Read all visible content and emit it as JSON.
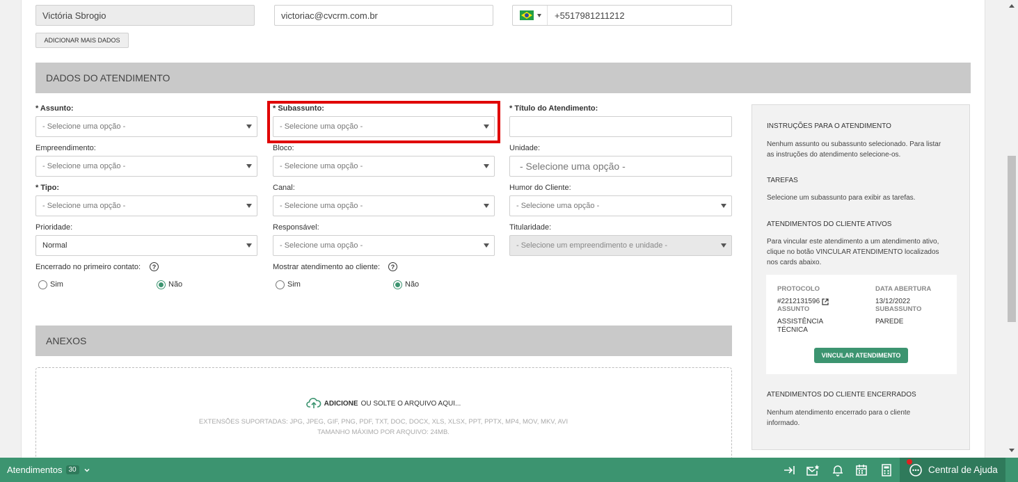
{
  "contact": {
    "name": "Victória Sbrogio",
    "email": "victoriac@cvcrm.com.br",
    "phone": "+5517981211212",
    "add_more_label": "ADICIONAR MAIS DADOS"
  },
  "section_atendimento": "DADOS DO ATENDIMENTO",
  "fields": {
    "assunto": {
      "label": "* Assunto:",
      "value": "- Selecione uma opção -"
    },
    "subassunto": {
      "label": "* Subassunto:",
      "value": "- Selecione uma opção -"
    },
    "titulo": {
      "label": "* Título do Atendimento:",
      "value": ""
    },
    "empreendimento": {
      "label": "Empreendimento:",
      "value": "- Selecione uma opção -"
    },
    "bloco": {
      "label": "Bloco:",
      "value": "- Selecione uma opção -"
    },
    "unidade": {
      "label": "Unidade:",
      "value": "- Selecione uma opção -"
    },
    "tipo": {
      "label": "* Tipo:",
      "value": "- Selecione uma opção -"
    },
    "canal": {
      "label": "Canal:",
      "value": "- Selecione uma opção -"
    },
    "humor": {
      "label": "Humor do Cliente:",
      "value": "- Selecione uma opção -"
    },
    "prioridade": {
      "label": "Prioridade:",
      "value": "Normal"
    },
    "responsavel": {
      "label": "Responsável:",
      "value": "- Selecione uma opção -"
    },
    "titularidade": {
      "label": "Titularidade:",
      "value": "- Selecione um empreendimento e unidade -"
    }
  },
  "encerrado": {
    "label": "Encerrado no primeiro contato:",
    "yes": "Sim",
    "no": "Não",
    "selected": "Não"
  },
  "mostrar": {
    "label": "Mostrar atendimento ao cliente:",
    "yes": "Sim",
    "no": "Não",
    "selected": "Não"
  },
  "section_anexos": "ANEXOS",
  "upload": {
    "action": "ADICIONE",
    "rest": "OU SOLTE O ARQUIVO AQUI...",
    "extensions": "EXTENSÕES SUPORTADAS: JPG, JPEG, GIF, PNG, PDF, TXT, DOC, DOCX, XLS, XLSX, PPT, PPTX, MP4, MOV, MKV, AVI",
    "max_size": "TAMANHO MÁXIMO POR ARQUIVO: 24MB."
  },
  "sidebar": {
    "instructions_title": "INSTRUÇÕES PARA O ATENDIMENTO",
    "instructions_text": "Nenhum assunto ou subassunto selecionado. Para listar as instruções do atendimento selecione-os.",
    "tasks_title": "TAREFAS",
    "tasks_text": "Selecione um subassunto para exibir as tarefas.",
    "active_title": "ATENDIMENTOS DO CLIENTE ATIVOS",
    "active_text": "Para vincular este atendimento a um atendimento ativo, clique no botão VINCULAR ATENDIMENTO localizados nos cards abaixo.",
    "card": {
      "protocol_label": "PROTOCOLO",
      "protocol_value": "#2212131596",
      "date_label": "DATA ABERTURA",
      "date_value": "13/12/2022",
      "assunto_label": "ASSUNTO",
      "assunto_value": "ASSISTÊNCIA TÉCNICA",
      "subassunto_label": "SUBASSUNTO",
      "subassunto_value": "PAREDE",
      "link_button": "VINCULAR ATENDIMENTO"
    },
    "closed_title": "ATENDIMENTOS DO CLIENTE ENCERRADOS",
    "closed_text": "Nenhum atendimento encerrado para o cliente informado."
  },
  "bottombar": {
    "label": "Atendimentos",
    "count": "30",
    "help": "Central de Ajuda"
  },
  "colors": {
    "primary": "#3c9470",
    "highlight": "#e00000",
    "section": "#c9c9c9"
  }
}
